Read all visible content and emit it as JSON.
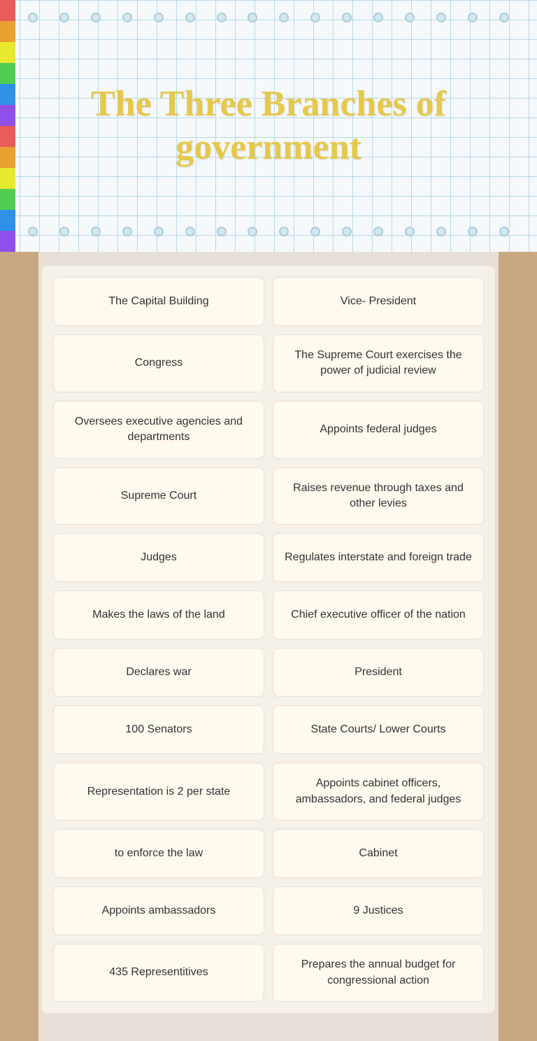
{
  "header": {
    "title": "The Three Branches of government"
  },
  "strips": [
    "#e85c5c",
    "#e8a030",
    "#e8e830",
    "#50cc50",
    "#3090e8",
    "#9050e8",
    "#e85c5c",
    "#e8a030",
    "#e8e830",
    "#50cc50",
    "#3090e8",
    "#9050e8"
  ],
  "cards": [
    {
      "id": "card-1",
      "text": "The Capital Building"
    },
    {
      "id": "card-2",
      "text": "Vice- President"
    },
    {
      "id": "card-3",
      "text": "Congress"
    },
    {
      "id": "card-4",
      "text": "The Supreme Court exercises the power of judicial review"
    },
    {
      "id": "card-5",
      "text": "Oversees executive agencies and departments"
    },
    {
      "id": "card-6",
      "text": "Appoints federal judges"
    },
    {
      "id": "card-7",
      "text": "Supreme Court"
    },
    {
      "id": "card-8",
      "text": "Raises revenue through taxes and other levies"
    },
    {
      "id": "card-9",
      "text": "Judges"
    },
    {
      "id": "card-10",
      "text": "Regulates interstate and foreign trade"
    },
    {
      "id": "card-11",
      "text": "Makes the laws of the land"
    },
    {
      "id": "card-12",
      "text": "Chief executive officer of the nation"
    },
    {
      "id": "card-13",
      "text": "Declares war"
    },
    {
      "id": "card-14",
      "text": "President"
    },
    {
      "id": "card-15",
      "text": "100 Senators"
    },
    {
      "id": "card-16",
      "text": "State Courts/ Lower Courts"
    },
    {
      "id": "card-17",
      "text": "Representation is 2 per state"
    },
    {
      "id": "card-18",
      "text": "Appoints cabinet officers, ambassadors, and federal judges"
    },
    {
      "id": "card-19",
      "text": "to enforce the law"
    },
    {
      "id": "card-20",
      "text": "Cabinet"
    },
    {
      "id": "card-21",
      "text": "Appoints ambassadors"
    },
    {
      "id": "card-22",
      "text": "9 Justices"
    },
    {
      "id": "card-23",
      "text": "435 Representitives"
    },
    {
      "id": "card-24",
      "text": "Prepares the annual budget for congressional action"
    }
  ],
  "dots": {
    "count": 16
  }
}
